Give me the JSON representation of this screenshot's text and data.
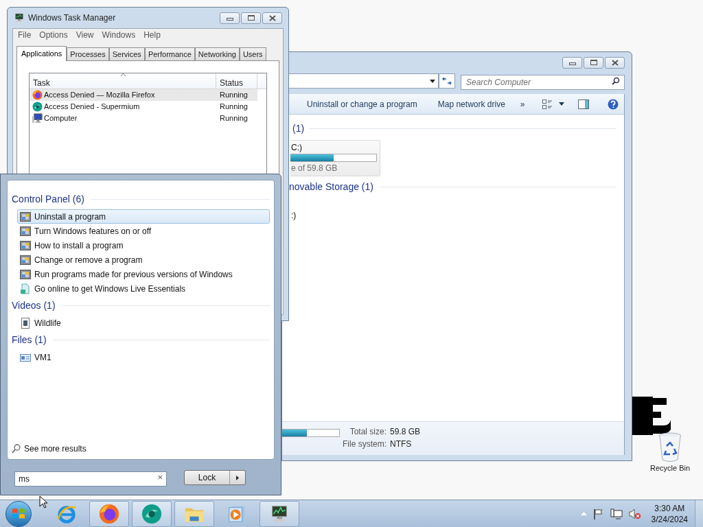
{
  "task_manager": {
    "title": "Windows Task Manager",
    "menu": [
      "File",
      "Options",
      "View",
      "Windows",
      "Help"
    ],
    "tabs": [
      {
        "label": "Applications",
        "selected": true
      },
      {
        "label": "Processes",
        "selected": false
      },
      {
        "label": "Services",
        "selected": false
      },
      {
        "label": "Performance",
        "selected": false
      },
      {
        "label": "Networking",
        "selected": false
      },
      {
        "label": "Users",
        "selected": false
      }
    ],
    "columns": [
      "Task",
      "Status"
    ],
    "rows": [
      {
        "kind": "firefox",
        "task": "Access Denied — Mozilla Firefox",
        "status": "Running",
        "selected": true
      },
      {
        "kind": "supermium",
        "task": "Access Denied - Supermium",
        "status": "Running",
        "selected": false
      },
      {
        "kind": "computer",
        "task": "Computer",
        "status": "Running",
        "selected": false
      }
    ]
  },
  "explorer": {
    "search": {
      "placeholder": "Search Computer"
    },
    "toolbar": [
      "Uninstall or change a program",
      "Map network drive",
      "»"
    ],
    "groups": [
      {
        "header": "(1)",
        "drive": {
          "label": "C:)",
          "level": 0.5,
          "caption": "e of 59.8 GB"
        }
      },
      {
        "header": "novable Storage (1)",
        "items": [
          ":)"
        ]
      }
    ],
    "details": {
      "level": 0.43,
      "fields": [
        {
          "label": "Total size:",
          "value": "59.8 GB"
        },
        {
          "label": "File system:",
          "value": "NTFS"
        }
      ]
    }
  },
  "start_menu": {
    "groups": [
      {
        "header": "Control Panel (6)",
        "items": [
          {
            "kind": "control-panel",
            "label": "Uninstall a program",
            "selected": true
          },
          {
            "kind": "control-panel",
            "label": "Turn Windows features on or off",
            "selected": false
          },
          {
            "kind": "control-panel",
            "label": "How to install a program",
            "selected": false
          },
          {
            "kind": "control-panel",
            "label": "Change or remove a program",
            "selected": false
          },
          {
            "kind": "control-panel",
            "label": "Run programs made for previous versions of Windows",
            "selected": false
          },
          {
            "kind": "download",
            "label": "Go online to get Windows Live Essentials",
            "selected": false
          }
        ]
      },
      {
        "header": "Videos (1)",
        "items": [
          {
            "kind": "video",
            "label": "Wildlife",
            "selected": false
          }
        ]
      },
      {
        "header": "Files (1)",
        "items": [
          {
            "kind": "file",
            "label": "VM1",
            "selected": false
          }
        ]
      }
    ],
    "see_more": "See more results",
    "search": {
      "value": "ms"
    },
    "clear": "×",
    "power_button": "Lock"
  },
  "taskbar": {
    "buttons": [
      {
        "kind": "ie",
        "running": false
      },
      {
        "kind": "firefox",
        "running": true
      },
      {
        "kind": "supermium",
        "running": true
      },
      {
        "kind": "folder",
        "running": true
      },
      {
        "kind": "media",
        "running": false
      },
      {
        "kind": "taskmgr",
        "running": true
      }
    ],
    "clock": {
      "time": "3:30 AM",
      "date": "3/24/2024"
    }
  },
  "desktop_icons": [
    {
      "label": "Recycle Bin"
    }
  ]
}
